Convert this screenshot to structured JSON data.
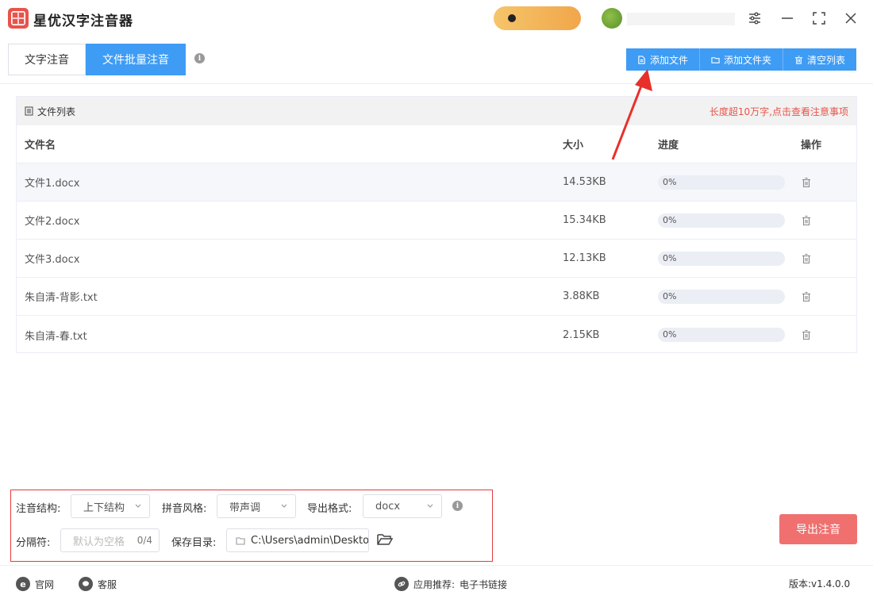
{
  "app": {
    "title": "星优汉字注音器"
  },
  "tabs": [
    {
      "label": "文字注音",
      "active": false
    },
    {
      "label": "文件批量注音",
      "active": true
    }
  ],
  "toolbar": {
    "add_file": "添加文件",
    "add_folder": "添加文件夹",
    "clear_list": "清空列表"
  },
  "file_list": {
    "title": "文件列表",
    "notice": "长度超10万字,点击查看注意事项",
    "columns": {
      "name": "文件名",
      "size": "大小",
      "progress": "进度",
      "action": "操作"
    },
    "rows": [
      {
        "name": "文件1.docx",
        "size": "14.53KB",
        "progress_label": "0%",
        "progress": 0
      },
      {
        "name": "文件2.docx",
        "size": "15.34KB",
        "progress_label": "0%",
        "progress": 0
      },
      {
        "name": "文件3.docx",
        "size": "12.13KB",
        "progress_label": "0%",
        "progress": 0
      },
      {
        "name": "朱自清-背影.txt",
        "size": "3.88KB",
        "progress_label": "0%",
        "progress": 0
      },
      {
        "name": "朱自清-春.txt",
        "size": "2.15KB",
        "progress_label": "0%",
        "progress": 0
      }
    ]
  },
  "settings": {
    "structure_label": "注音结构:",
    "structure_value": "上下结构",
    "style_label": "拼音风格:",
    "style_value": "带声调",
    "format_label": "导出格式:",
    "format_value": "docx",
    "separator_label": "分隔符:",
    "separator_placeholder": "默认为空格",
    "separator_count": "0/4",
    "save_label": "保存目录:",
    "save_value": "C:\\Users\\admin\\Deskto"
  },
  "export_button": "导出注音",
  "footer": {
    "website": "官网",
    "service": "客服",
    "recommend_label": "应用推荐:",
    "recommend_link": "电子书链接",
    "version": "版本:v1.4.0.0"
  },
  "colors": {
    "primary": "#3e9cf5",
    "export": "#f07070",
    "notice": "#e8534a",
    "highlight_border": "#e83b3b",
    "user_pill": "#f1a64a"
  }
}
